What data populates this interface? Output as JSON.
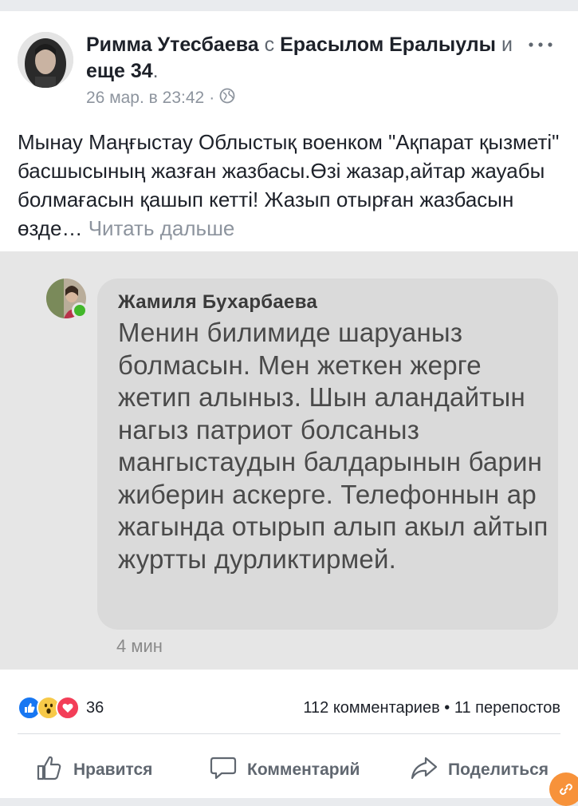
{
  "post": {
    "author": "Римма Утесбаева",
    "with_word": "с",
    "tagged": "Ерасылом Ералыулы",
    "and_word": "и",
    "others": "еще 34",
    "period": ".",
    "timestamp": "26 мар. в 23:42",
    "separator": "·",
    "privacy_icon": "globe-icon",
    "more_icon": "more-dots-icon",
    "text": "Мынау Маңғыстау Облыстық военком \"Ақпарат қызметі\" басшысының жазған жазбасы.Өзі жазар,айтар жауабы болмағасын қашып кетті! Жазып отырған жазбасын өзде…",
    "read_more": "Читать дальше"
  },
  "embedded_comment": {
    "author": "Жамиля Бухарбаева",
    "body": "Менин билимиде шаруаныз болмасын. Мен жеткен жерге жетип алыныз. Шын аландайтын нагыз патриот болсаныз мангыстаудын балдарынын барин жиберин аскерге. Телефоннын ар жагында отырып алып акыл айтып журтты дурликтирмей.",
    "time": "4 мин"
  },
  "footer": {
    "reaction_icons": [
      "like-icon",
      "wow-icon",
      "love-icon"
    ],
    "reaction_count": "36",
    "comments": "112 комментариев",
    "dot": "•",
    "shares": "11 перепостов"
  },
  "actions": {
    "like": "Нравится",
    "comment": "Комментарий",
    "share": "Поделиться"
  },
  "colors": {
    "like_blue": "#1877f2",
    "wow_yellow": "#f7c948",
    "love_red": "#f33e58",
    "online_green": "#42b72a"
  }
}
